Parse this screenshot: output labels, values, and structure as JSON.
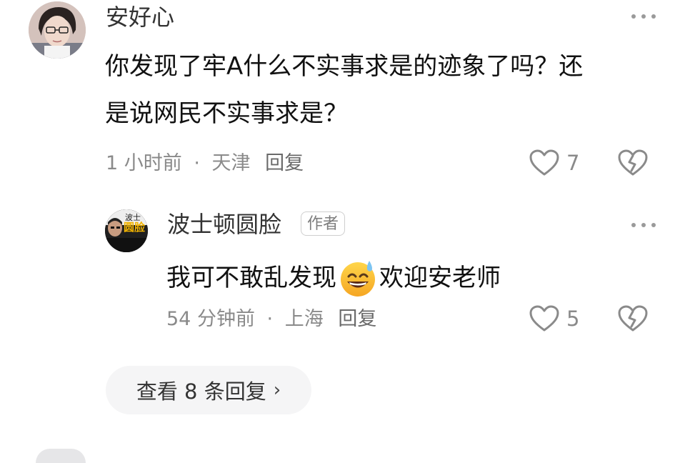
{
  "comment": {
    "author": "安好心",
    "text_line1": "你发现了牢A什么不实事求是的迹象了吗？还",
    "text_line2": "是说网民不实事求是？",
    "time": "1 小时前",
    "separator": "·",
    "location": "天津",
    "reply_label": "回复",
    "like_count": "7"
  },
  "reply": {
    "author": "波士顿圆脸",
    "author_badge": "作者",
    "avatar_text_top": "波士",
    "avatar_text_main": "圆脸",
    "text_before_emoji": "我可不敢乱发现",
    "text_after_emoji": "欢迎安老师",
    "emoji_icon": "sweat-smile-emoji",
    "time": "54 分钟前",
    "separator": "·",
    "location": "上海",
    "reply_label": "回复",
    "like_count": "5"
  },
  "view_replies": {
    "label": "查看 8 条回复",
    "chevron": "›"
  },
  "icons": {
    "like": "heart-outline-icon",
    "dislike": "broken-heart-icon",
    "more": "more-dots-icon"
  },
  "colors": {
    "text": "#111111",
    "meta": "#8a8a8a",
    "icon": "#8a8a8a",
    "pill_bg": "#f5f5f6"
  }
}
